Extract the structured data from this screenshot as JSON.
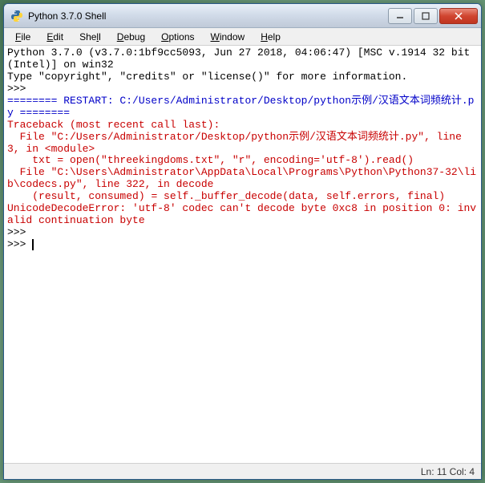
{
  "titlebar": {
    "title": "Python 3.7.0 Shell"
  },
  "menubar": {
    "items": [
      {
        "label": "File",
        "underline": "F"
      },
      {
        "label": "Edit",
        "underline": "E"
      },
      {
        "label": "Shell",
        "underline": "S"
      },
      {
        "label": "Debug",
        "underline": "D"
      },
      {
        "label": "Options",
        "underline": "O"
      },
      {
        "label": "Window",
        "underline": "W"
      },
      {
        "label": "Help",
        "underline": "H"
      }
    ]
  },
  "content": {
    "banner1": "Python 3.7.0 (v3.7.0:1bf9cc5093, Jun 27 2018, 04:06:47) [MSC v.1914 32 bit (Intel)] on win32",
    "banner2": "Type \"copyright\", \"credits\" or \"license()\" for more information.",
    "prompt1": ">>> ",
    "restart": "======== RESTART: C:/Users/Administrator/Desktop/python示例/汉语文本词频统计.py ========",
    "trace1": "Traceback (most recent call last):",
    "trace2": "  File \"C:/Users/Administrator/Desktop/python示例/汉语文本词频统计.py\", line 3, in <module>",
    "trace3": "    txt = open(\"threekingdoms.txt\", \"r\", encoding='utf-8').read()",
    "trace4": "  File \"C:\\Users\\Administrator\\AppData\\Local\\Programs\\Python\\Python37-32\\lib\\codecs.py\", line 322, in decode",
    "trace5": "    (result, consumed) = self._buffer_decode(data, self.errors, final)",
    "error": "UnicodeDecodeError: 'utf-8' codec can't decode byte 0xc8 in position 0: invalid continuation byte",
    "prompt2": ">>> ",
    "prompt3": ">>> "
  },
  "statusbar": {
    "text": "Ln: 11   Col: 4"
  },
  "watermark": ""
}
